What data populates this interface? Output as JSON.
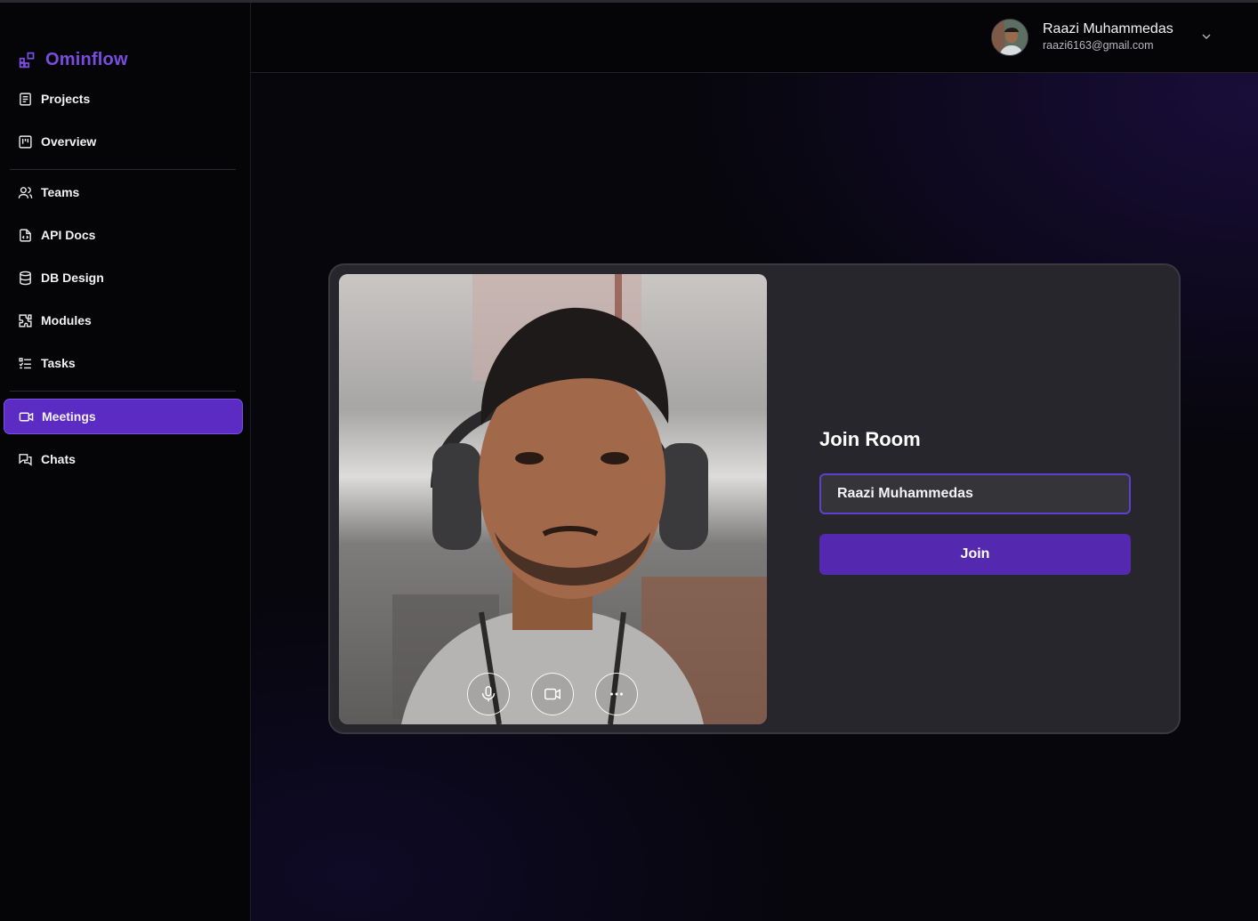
{
  "app": {
    "brand": "Ominflow",
    "brand_icon": "layout-blocks-icon",
    "accent_color": "#7a4ce0",
    "active_color": "#5b2bc4"
  },
  "sidebar": {
    "items": [
      {
        "label": "Projects",
        "icon": "document-list-icon"
      },
      {
        "label": "Overview",
        "icon": "kanban-icon"
      },
      {
        "label": "Teams",
        "icon": "users-icon"
      },
      {
        "label": "API Docs",
        "icon": "file-code-icon"
      },
      {
        "label": "DB Design",
        "icon": "database-icon"
      },
      {
        "label": "Modules",
        "icon": "puzzle-icon"
      },
      {
        "label": "Tasks",
        "icon": "checklist-icon"
      },
      {
        "label": "Meetings",
        "icon": "video-icon",
        "active": true
      },
      {
        "label": "Chats",
        "icon": "chat-bubbles-icon"
      }
    ]
  },
  "header": {
    "user_name": "Raazi Muhammedas",
    "user_email": "raazi6163@gmail.com"
  },
  "meeting": {
    "title": "Join Room",
    "name_value": "Raazi Muhammedas",
    "join_label": "Join",
    "controls": [
      "microphone-icon",
      "camera-icon",
      "more-icon"
    ]
  }
}
